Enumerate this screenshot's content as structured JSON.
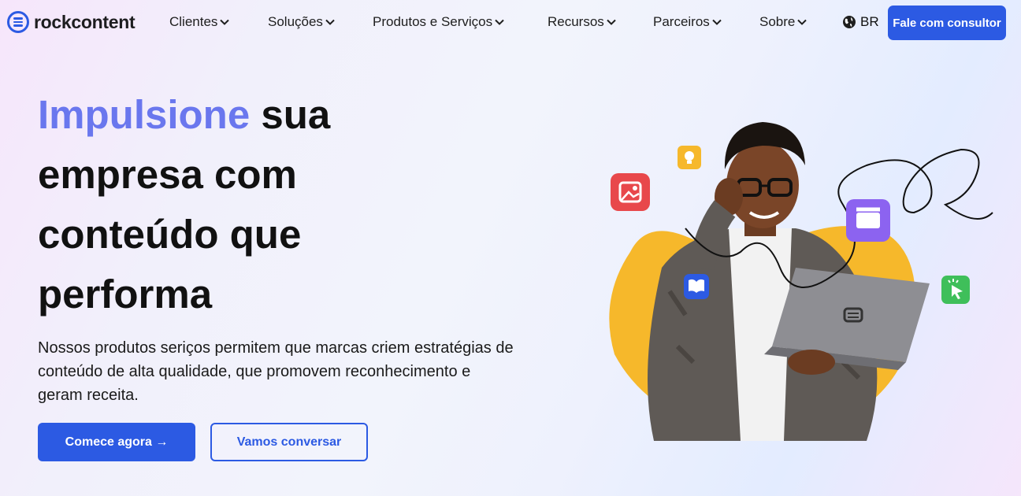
{
  "brand": {
    "name": "rockcontent",
    "color": "#2c5ae3"
  },
  "nav": {
    "items": [
      {
        "label": "Clientes"
      },
      {
        "label": "Soluções"
      },
      {
        "label": "Produtos e Serviços"
      },
      {
        "label": "Recursos"
      },
      {
        "label": "Parceiros"
      },
      {
        "label": "Sobre"
      }
    ],
    "language": "BR",
    "cta": "Fale com consultor"
  },
  "hero": {
    "headline": {
      "accent": "Impulsione",
      "line1_rest": " sua",
      "line2": "empresa com",
      "line3": "conteúdo que",
      "line4": "performa"
    },
    "subtitle": "Nossos produtos seriços permitem que marcas criem estratégias de conteúdo de alta qualidade, que promovem reconhecimento e geram receita.",
    "primary_cta": "Comece agora →",
    "secondary_cta": "Vamos conversar"
  },
  "colors": {
    "accent": "#6a77ee",
    "primary": "#2c5ae3",
    "blob": "#f6b82b"
  },
  "icons": [
    "globe-icon",
    "image-icon",
    "lightbulb-icon",
    "clapperboard-icon",
    "book-icon",
    "cursor-click-icon",
    "chevron-down-icon"
  ]
}
